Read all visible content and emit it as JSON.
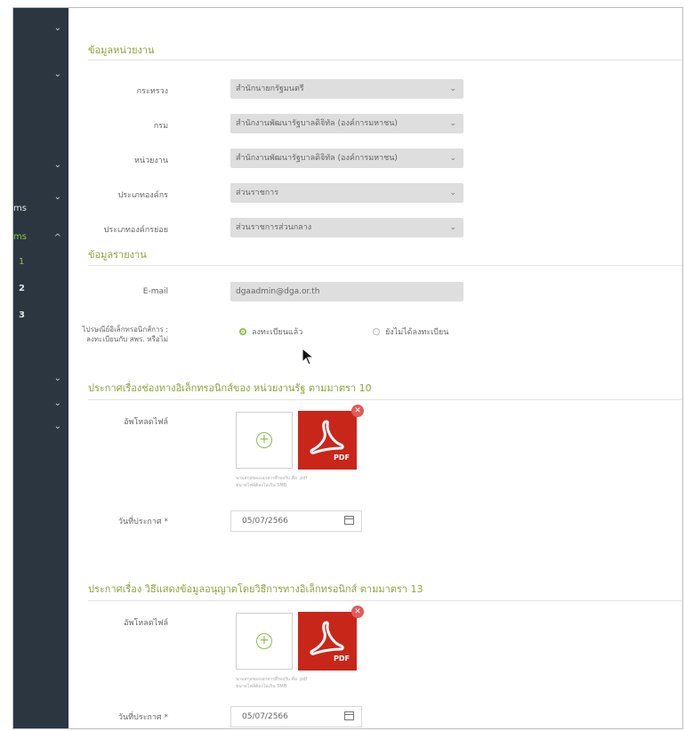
{
  "sidebar": {
    "items": [
      {
        "fragment": "",
        "chevron": "⌄"
      },
      {
        "fragment": "",
        "chevron": "⌄"
      },
      {
        "fragment": "",
        "chevron": ""
      },
      {
        "fragment": "",
        "chevron": "⌄"
      },
      {
        "fragment": "ms",
        "chevron": "⌄"
      },
      {
        "fragment": "ms",
        "chevron": "^"
      },
      {
        "fragment": "1",
        "chevron": ""
      },
      {
        "fragment": "2",
        "chevron": ""
      },
      {
        "fragment": "3",
        "chevron": ""
      },
      {
        "fragment": "",
        "chevron": ""
      },
      {
        "fragment": "",
        "chevron": "⌄"
      },
      {
        "fragment": "",
        "chevron": "⌄"
      },
      {
        "fragment": "",
        "chevron": "⌄"
      }
    ]
  },
  "agency_section": {
    "title": "ข้อมูลหน่วยงาน",
    "fields": [
      {
        "label": "กระทรวง",
        "value": "สำนักนายกรัฐมนตรี"
      },
      {
        "label": "กรม",
        "value": "สำนักงานพัฒนารัฐบาลดิจิทัล (องค์การมหาชน)"
      },
      {
        "label": "หน่วยงาน",
        "value": "สำนักงานพัฒนารัฐบาลดิจิทัล (องค์การมหาชน)"
      },
      {
        "label": "ประเภทองค์กร",
        "value": "ส่วนราชการ"
      },
      {
        "label": "ประเภทองค์กรย่อย",
        "value": "ส่วนราชการส่วนกลาง"
      }
    ]
  },
  "report_section": {
    "title": "ข้อมูลรายงาน",
    "email_label": "E-mail",
    "email_value": "dgaadmin@dga.or.th",
    "registration_question_line1": "ไปรษณีย์อิเล็กทรอนิกส์การ :",
    "registration_question_line2": "ลงทะเบียนกับ สพร. หรือไม่",
    "option_registered": "ลงทะเบียนแล้ว",
    "option_not_registered": "ยังไม่ได้ลงทะเบียน"
  },
  "announcement_10": {
    "title": "ประกาศเรื่องช่องทางอิเล็กทรอนิกส์ของ หน่วยงานรัฐ ตามมาตรา 10",
    "upload_label": "อัพโหลดไฟล์",
    "pdf_text": "PDF",
    "remove_icon": "✕",
    "add_icon": "+",
    "hint_line1": "นามสกุลของเอกสารที่รองรับ คือ .pdf",
    "hint_line2": "ขนาดไฟล์ต้องไม่เกิน 5MB",
    "date_label": "วันที่ประกาศ *",
    "date_value": "05/07/2566"
  },
  "announcement_13": {
    "title": "ประกาศเรื่อง วิธีแสดงข้อมูลอนุญาตโดยวิธีการทางอิเล็กทรอนิกส์ ตามมาตรา 13",
    "upload_label": "อัพโหลดไฟล์",
    "pdf_text": "PDF",
    "remove_icon": "✕",
    "add_icon": "+",
    "hint_line1": "นามสกุลของเอกสารที่รองรับ คือ .pdf",
    "hint_line2": "ขนาดไฟล์ต้องไม่เกิน 5MB",
    "date_label": "วันที่ประกาศ *",
    "date_value": "05/07/2566"
  },
  "colors": {
    "sidebar_bg": "#2b3640",
    "accent_green": "#8bc34a",
    "section_title": "#8ca33a",
    "pdf_red": "#c9261a",
    "remove_red": "#e25a5a",
    "field_gray": "#dedede"
  },
  "icons": {
    "caret": "chevron-down-icon",
    "calendar": "calendar-icon",
    "add": "plus-circle-icon",
    "pdf": "pdf-file-icon",
    "remove": "close-icon",
    "cursor": "mouse-pointer-icon"
  }
}
